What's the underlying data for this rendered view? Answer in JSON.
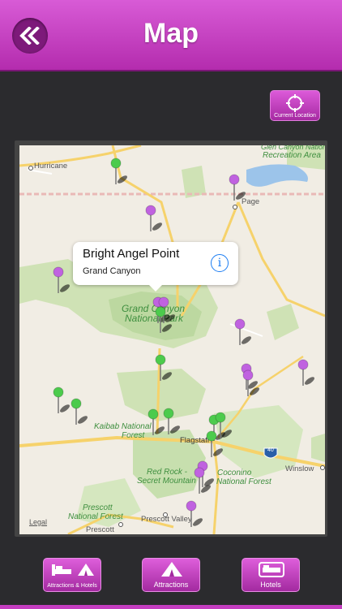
{
  "header": {
    "title": "Map",
    "back_icon": "double-chevron-left-icon",
    "color": "#c53fc1"
  },
  "map": {
    "current_location_label": "Current Location",
    "labels": {
      "hurricane": "Hurricane",
      "page": "Page",
      "recreation_area_1": "Glen Canyon National",
      "recreation_area_2": "Recreation Area",
      "grand_canyon_np_1": "Grand Canyon",
      "grand_canyon_np_2": "National Park",
      "kaibab_1": "Kaibab National",
      "kaibab_2": "Forest",
      "flagstaff": "Flagstaff",
      "red_rock_1": "Red Rock -",
      "red_rock_2": "Secret Mountain",
      "coconino_1": "Coconino",
      "coconino_2": "National Forest",
      "prescott_nf_1": "Prescott",
      "prescott_nf_2": "National Forest",
      "prescott_valley": "Prescott Valley",
      "prescott": "Prescott",
      "winslow": "Winslow",
      "interstate": "40",
      "legal": "Legal"
    },
    "callout": {
      "title": "Bright Angel Point",
      "subtitle": "Grand Canyon"
    }
  },
  "tabs": [
    {
      "label": "Attractions & Hotels",
      "icon": "bed-and-tent-icon"
    },
    {
      "label": "Attractions",
      "icon": "tent-icon"
    },
    {
      "label": "Hotels",
      "icon": "bed-icon"
    }
  ]
}
